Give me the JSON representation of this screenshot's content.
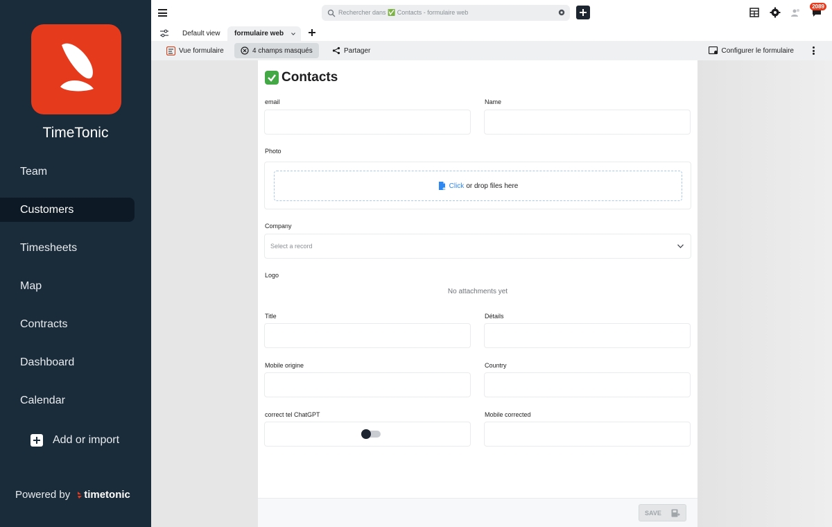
{
  "sidebar": {
    "brand": "TimeTonic",
    "items": [
      {
        "label": "Team"
      },
      {
        "label": "Customers"
      },
      {
        "label": "Timesheets"
      },
      {
        "label": "Map"
      },
      {
        "label": "Contracts"
      },
      {
        "label": "Dashboard"
      },
      {
        "label": "Calendar"
      }
    ],
    "add_import": "Add or import",
    "powered_by": "Powered by",
    "powered_brand": "timetonic"
  },
  "topbar": {
    "search_placeholder": "Rechercher dans ✅ Contacts - formulaire web",
    "notification_count": "2089"
  },
  "tabs": {
    "default_view": "Default view",
    "active_tab": "formulaire web"
  },
  "toolbar": {
    "vue": "Vue formulaire",
    "masked": "4 champs masqués",
    "share": "Partager",
    "configure": "Configurer le formulaire"
  },
  "form": {
    "title": "Contacts",
    "fields": {
      "email": "email",
      "name": "Name",
      "photo": "Photo",
      "company": "Company",
      "logo": "Logo",
      "title": "Title",
      "details": "Détails",
      "mobile_origin": "Mobile origine",
      "country": "Country",
      "correct_tel": "correct tel ChatGPT",
      "mobile_corrected": "Mobile corrected"
    },
    "dropzone_click": "Click",
    "dropzone_rest": "or drop files here",
    "select_placeholder": "Select a record",
    "no_attachments": "No attachments yet",
    "save": "SAVE"
  },
  "colors": {
    "sidebar_bg": "#1a2b3a",
    "brand_red": "#e63a1d",
    "link_blue": "#2f88f0"
  }
}
